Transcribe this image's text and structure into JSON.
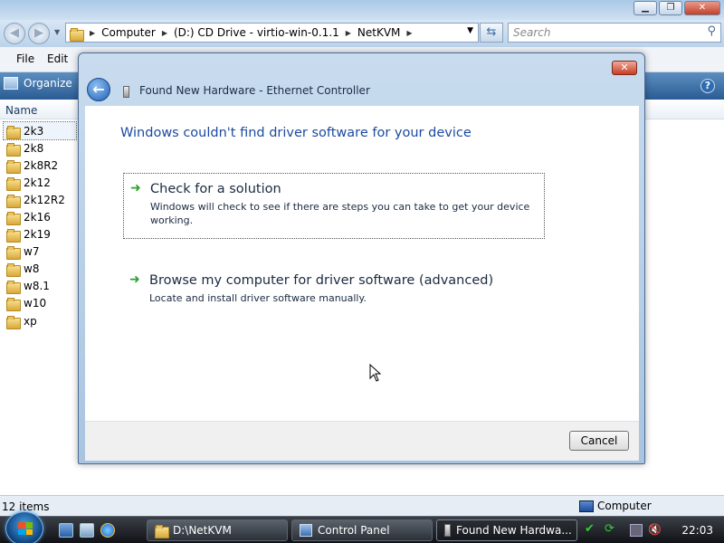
{
  "explorer": {
    "address": {
      "crumbs": [
        "Computer",
        "(D:) CD Drive - virtio-win-0.1.1",
        "NetKVM"
      ]
    },
    "search_placeholder": "Search",
    "menu": {
      "file": "File",
      "edit": "Edit"
    },
    "toolbar": {
      "organize": "Organize"
    },
    "column_header": "Name",
    "files": [
      "2k3",
      "2k8",
      "2k8R2",
      "2k12",
      "2k12R2",
      "2k16",
      "2k19",
      "w7",
      "w8",
      "w8.1",
      "w10",
      "xp"
    ],
    "status": {
      "count": "12 items",
      "location": "Computer"
    }
  },
  "dialog": {
    "title": "Found New Hardware - Ethernet Controller",
    "heading": "Windows couldn't find driver software for your device",
    "option1": {
      "title": "Check for a solution",
      "description": "Windows will check to see if there are steps you can take to get your device working."
    },
    "option2": {
      "title": "Browse my computer for driver software (advanced)",
      "description": "Locate and install driver software manually."
    },
    "cancel_label": "Cancel"
  },
  "taskbar": {
    "tasks": [
      "D:\\NetKVM",
      "Control Panel",
      "Found New Hardwa..."
    ],
    "clock": "22:03"
  },
  "colors": {
    "heading_blue": "#1c4ba0",
    "taskbar_dark": "#101216",
    "arrow_green": "#2ea12e"
  }
}
